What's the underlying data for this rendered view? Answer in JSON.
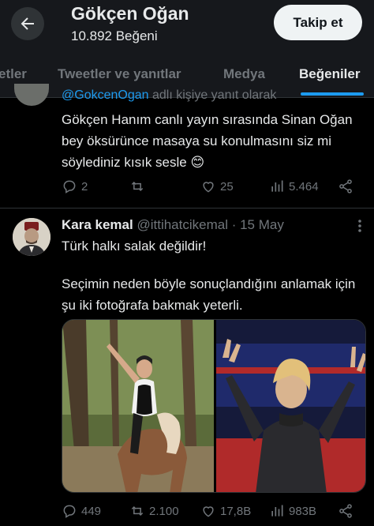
{
  "header": {
    "title": "Gökçen Oğan",
    "subtitle": "10.892 Beğeni",
    "follow_label": "Takip et"
  },
  "tabs": [
    {
      "label": "etler",
      "active": false
    },
    {
      "label": "Tweetler ve yanıtlar",
      "active": false
    },
    {
      "label": "Medya",
      "active": false
    },
    {
      "label": "Beğeniler",
      "active": true
    }
  ],
  "tweet1": {
    "reply_mention": "@GokcenOgan",
    "reply_text": " adlı kişiye yanıt olarak",
    "text": "Gökçen Hanım canlı yayın sırasında Sinan Oğan bey öksürünce masaya su konulmasını siz mi söylediniz kısık sesle 😊",
    "replies": "2",
    "retweets": "",
    "likes": "25",
    "views": "5.464"
  },
  "tweet2": {
    "name": "Kara kemal",
    "handle": "@ittihatcikemal",
    "date": "· 15 May",
    "text_line1": "Türk halkı salak değildir!",
    "text_line2": "Seçimin neden böyle sonuçlandığını anlamak için şu iki fotoğrafa bakmak yeterli.",
    "replies": "449",
    "retweets": "2.100",
    "likes": "17,8B",
    "views": "983B"
  },
  "colors": {
    "accent": "#1d9bf0",
    "muted": "#71767b",
    "background": "#000000"
  }
}
